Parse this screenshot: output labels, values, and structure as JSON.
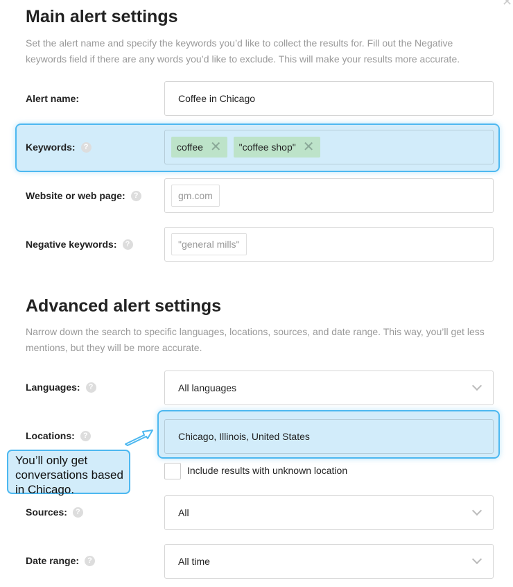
{
  "main": {
    "title": "Main alert settings",
    "description": "Set the alert name and specify the keywords you’d like to collect the results for. Fill out the Negative keywords field if there are any words you’d like to exclude. This will make your results more accurate.",
    "alert_name": {
      "label": "Alert name:",
      "value": "Coffee in Chicago"
    },
    "keywords": {
      "label": "Keywords:",
      "tags": [
        "coffee",
        "\"coffee shop\""
      ]
    },
    "website": {
      "label": "Website or web page:",
      "placeholder": "gm.com"
    },
    "negative": {
      "label": "Negative keywords:",
      "placeholder": "\"general mills\""
    }
  },
  "advanced": {
    "title": "Advanced alert settings",
    "description": "Narrow down the search to specific languages, locations, sources, and date range. This way, you’ll get less mentions, but they will be more accurate.",
    "languages": {
      "label": "Languages:",
      "value": "All languages"
    },
    "locations": {
      "label": "Locations:",
      "value": "Chicago, Illinois, United States"
    },
    "unknown_location": {
      "label": "Include results with unknown location",
      "checked": false
    },
    "sources": {
      "label": "Sources:",
      "value": "All"
    },
    "date_range": {
      "label": "Date range:",
      "value": "All time"
    }
  },
  "callout": {
    "text": "You’ll only get conversations based in Chicago."
  },
  "help_glyph": "?",
  "remove_glyph": "✕",
  "colors": {
    "highlight": "#4db8f0",
    "highlight_bg": "#d2ecfa",
    "tag_bg": "#bde3c9"
  }
}
